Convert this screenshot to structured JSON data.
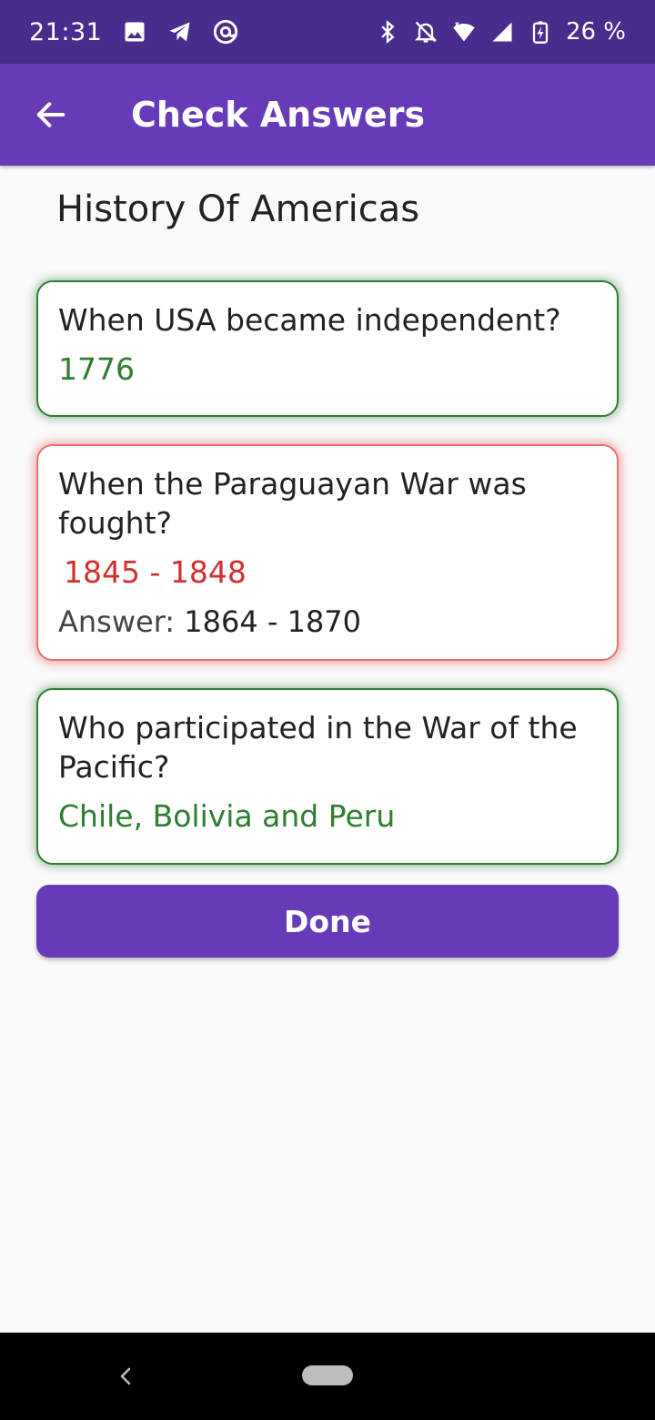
{
  "status_bar": {
    "time": "21:31",
    "battery": "26 %",
    "icons_left": [
      "image-icon",
      "telegram-icon",
      "at-sign-icon"
    ],
    "icons_right": [
      "bluetooth-icon",
      "notifications-off-icon",
      "wifi-icon",
      "signal-icon",
      "battery-charging-icon"
    ]
  },
  "app_bar": {
    "title": "Check Answers",
    "back_icon": "arrow-left-icon"
  },
  "quiz": {
    "title": "History Of Americas",
    "questions": [
      {
        "question": "When USA became independent?",
        "user_answer": "1776",
        "status": "correct"
      },
      {
        "question": "When the Paraguayan War was fought?",
        "user_answer": "1845 - 1848",
        "status": "wrong",
        "answer_label": "Answer:",
        "correct_answer": "1864 - 1870"
      },
      {
        "question": "Who participated in the War of the Pacific?",
        "user_answer": "Chile, Bolivia and Peru",
        "status": "correct"
      }
    ],
    "done_label": "Done"
  },
  "colors": {
    "primary": "#673ab7",
    "status_bar": "#4a2c8c",
    "correct": "#2e7d32",
    "wrong": "#d32f2f"
  }
}
